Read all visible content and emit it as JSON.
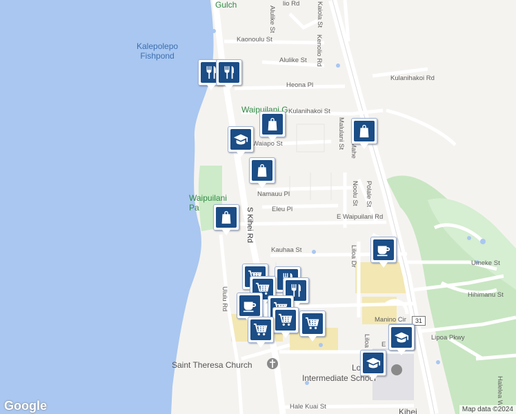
{
  "water_labels": [
    "Kalepolepo\nFishpond"
  ],
  "park_labels": [
    "Gulch",
    "Waipuilani G",
    "Waipuilani\nPa"
  ],
  "street_labels": [
    "Kaonoulu St",
    "Alulike St",
    "Alulike St",
    "Kaiola St",
    "Kenolio Rd",
    "Heona Pl",
    "Kulanihakoi Rd",
    "Kulanihakoi St",
    "Waiapo St",
    "Malulani St",
    "Namauu Pl",
    "S Kihei Rd",
    "Eleu Pl",
    "E Waipuilani Rd",
    "Polale St",
    "Noolu St",
    "Kauhaa St",
    "Liloa Dr",
    "Umeke St",
    "Hihimanu St",
    "Manino Cir",
    "Ululu Rd",
    "Lipoa Pkwy",
    "Liloa Dr",
    "Hale Kuai St",
    "Halelea W",
    "Mahe",
    "lio Rd",
    "E"
  ],
  "poi_labels": [
    "Saint Theresa Church",
    "Lo",
    "Intermediate School",
    "Kihei"
  ],
  "route_shield": "31",
  "logo": "Google",
  "attribution": "Map data ©2024",
  "markers": [
    {
      "type": "restaurant-icon"
    },
    {
      "type": "restaurant-icon"
    },
    {
      "type": "shopping-icon"
    },
    {
      "type": "school-icon"
    },
    {
      "type": "shopping-icon"
    },
    {
      "type": "shopping-icon"
    },
    {
      "type": "shopping-icon"
    },
    {
      "type": "cafe-icon"
    },
    {
      "type": "shopping-icon"
    },
    {
      "type": "restaurant-icon"
    },
    {
      "type": "restaurant-icon"
    },
    {
      "type": "grocery-icon"
    },
    {
      "type": "grocery-icon"
    },
    {
      "type": "cafe-icon"
    },
    {
      "type": "grocery-icon"
    },
    {
      "type": "grocery-icon"
    },
    {
      "type": "grocery-icon"
    },
    {
      "type": "grocery-icon"
    },
    {
      "type": "school-icon"
    },
    {
      "type": "school-icon"
    }
  ]
}
